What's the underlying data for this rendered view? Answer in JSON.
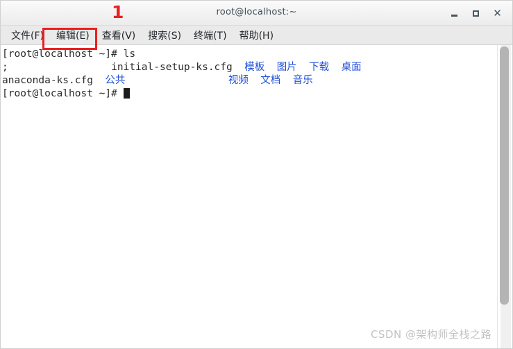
{
  "window": {
    "title": "root@localhost:~",
    "controls": {
      "minimize_label": "–",
      "maximize_label": "□",
      "close_label": "✕"
    }
  },
  "annotation": {
    "number_label": "1",
    "color": "#e8201f",
    "highlights_menu_item": "编辑(E)"
  },
  "menubar": {
    "items": [
      {
        "label": "文件(F)"
      },
      {
        "label": "编辑(E)"
      },
      {
        "label": "查看(V)"
      },
      {
        "label": "搜索(S)"
      },
      {
        "label": "终端(T)"
      },
      {
        "label": "帮助(H)"
      }
    ]
  },
  "terminal": {
    "colors": {
      "foreground": "#2b2b2b",
      "background": "#ffffff",
      "directory_blue": "#1f4fd8"
    },
    "lines": [
      {
        "id": "line-prompt-ls",
        "segments": [
          {
            "text": "[root@localhost ~]# ls",
            "color": "fg"
          }
        ]
      },
      {
        "id": "line-listing-1",
        "segments": [
          {
            "text": ";",
            "color": "fg"
          },
          {
            "text": "                 ",
            "color": "fg"
          },
          {
            "text": "initial-setup-ks.cfg",
            "color": "fg"
          },
          {
            "text": "  ",
            "color": "fg"
          },
          {
            "text": "模板",
            "color": "blue"
          },
          {
            "text": "  ",
            "color": "fg"
          },
          {
            "text": "图片",
            "color": "blue"
          },
          {
            "text": "  ",
            "color": "fg"
          },
          {
            "text": "下载",
            "color": "blue"
          },
          {
            "text": "  ",
            "color": "fg"
          },
          {
            "text": "桌面",
            "color": "blue"
          }
        ]
      },
      {
        "id": "line-listing-2",
        "segments": [
          {
            "text": "anaconda-ks.cfg",
            "color": "fg"
          },
          {
            "text": "  ",
            "color": "fg"
          },
          {
            "text": "公共",
            "color": "blue"
          },
          {
            "text": "                 ",
            "color": "fg"
          },
          {
            "text": "视频",
            "color": "blue"
          },
          {
            "text": "  ",
            "color": "fg"
          },
          {
            "text": "文档",
            "color": "blue"
          },
          {
            "text": "  ",
            "color": "fg"
          },
          {
            "text": "音乐",
            "color": "blue"
          }
        ]
      },
      {
        "id": "line-prompt-cursor",
        "segments": [
          {
            "text": "[root@localhost ~]# ",
            "color": "fg"
          },
          {
            "text": "",
            "color": "cursor"
          }
        ]
      }
    ]
  },
  "watermark": {
    "text": "CSDN @架构师全栈之路"
  }
}
